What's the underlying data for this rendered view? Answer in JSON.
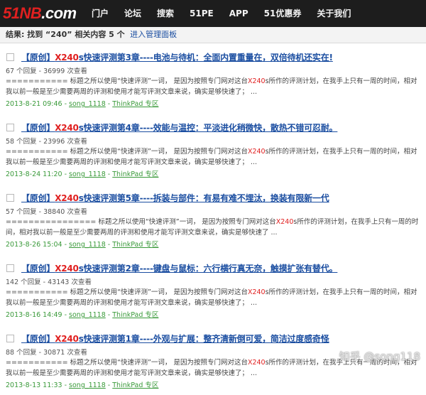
{
  "header": {
    "logo_red": "51NB",
    "logo_white": ".com",
    "nav": [
      "门户",
      "论坛",
      "搜索",
      "51PE",
      "APP",
      "51优惠券",
      "关于我们"
    ]
  },
  "summary": {
    "prefix": "结果: 找到 “",
    "keyword": "240",
    "middle": "” 相关内容 ",
    "count": "5",
    "suffix": " 个",
    "admin_link": "进入管理面板"
  },
  "results": [
    {
      "title_prefix": "【原创】",
      "title_kw": "X240",
      "title_rest": "s快速评测第3章----电池与待机：全面内置重量在，双倍待机还实在!",
      "meta": "67 个回复 - 36999 次查看",
      "snippet_a": "=========== 标题之所以使用“快速评测”一词，  是因为按照专门网对这台",
      "snippet_kw": "X240",
      "snippet_b": "s所作的评测计划，在我手上只有一周的时间，相对我以前一般是至少需要两周的评测和使用才能写评测文章来说，确实是够快速了；  ...",
      "date": "2013-8-21 09:46",
      "author": "song_1118",
      "forum": "ThinkPad 专区"
    },
    {
      "title_prefix": "【原创】",
      "title_kw": "X240",
      "title_rest": "s快速评测第4章----效能与温控：平淡进化稍微快，散热不错可忍耐。",
      "meta": "58 个回复 - 23996 次查看",
      "snippet_a": "=========== 标题之所以使用“快速评测”一词，  是因为按照专门网对这台",
      "snippet_kw": "X240",
      "snippet_b": "s所作的评测计划，在我手上只有一周的时间，相对我以前一般是至少需要两周的评测和使用才能写评测文章来说，确实是够快速了；  ...",
      "date": "2013-8-24 11:20",
      "author": "song_1118",
      "forum": "ThinkPad 专区"
    },
    {
      "title_prefix": "【原创】",
      "title_kw": "X240",
      "title_rest": "s快速评测第5章----拆装与部件：有易有难不埋汰，换装有限新一代",
      "meta": "57 个回复 - 38840 次查看",
      "snippet_a": "================ 标题之所以使用“快速评测”一词，  是因为按照专门网对这台",
      "snippet_kw": "X240",
      "snippet_b": "s所作的评测计划，在我手上只有一周的时间，相对我以前一般是至少需要两周的评测和使用才能写评测文章来说，确实是够快速了  ...",
      "date": "2013-8-26 15:04",
      "author": "song_1118",
      "forum": "ThinkPad 专区"
    },
    {
      "title_prefix": "【原创】",
      "title_kw": "X240",
      "title_rest": "s快速评测第2章----键盘与鼠标：六行横行真无奈，触摸扩张有替代。",
      "meta": "142 个回复 - 43143 次查看",
      "snippet_a": "=========== 标题之所以使用“快速评测”一词，  是因为按照专门网对这台",
      "snippet_kw": "X240",
      "snippet_b": "s所作的评测计划，在我手上只有一周的时间，相对我以前一般是至少需要两周的评测和使用才能写评测文章来说，确实是够快速了；  ...",
      "date": "2013-8-16 14:49",
      "author": "song_1118",
      "forum": "ThinkPad 专区"
    },
    {
      "title_prefix": "【原创】",
      "title_kw": "X240",
      "title_rest": "s快速评测第1章----外观与扩展：整齐清新倒可爱，简洁过度感奇怪",
      "meta": "88 个回复 - 30871 次查看",
      "snippet_a": "=========== 标题之所以使用“快速评测”一词，  是因为按照专门网对这台",
      "snippet_kw": "X240",
      "snippet_b": "s所作的评测计划，在我手上只有一周的时间，相对我以前一般是至少需要两周的评测和使用才能写评测文章来说，确实是够快速了；  ...",
      "date": "2013-8-13 11:33",
      "author": "song_1118",
      "forum": "ThinkPad 专区"
    }
  ],
  "watermark": "知乎 @song118"
}
